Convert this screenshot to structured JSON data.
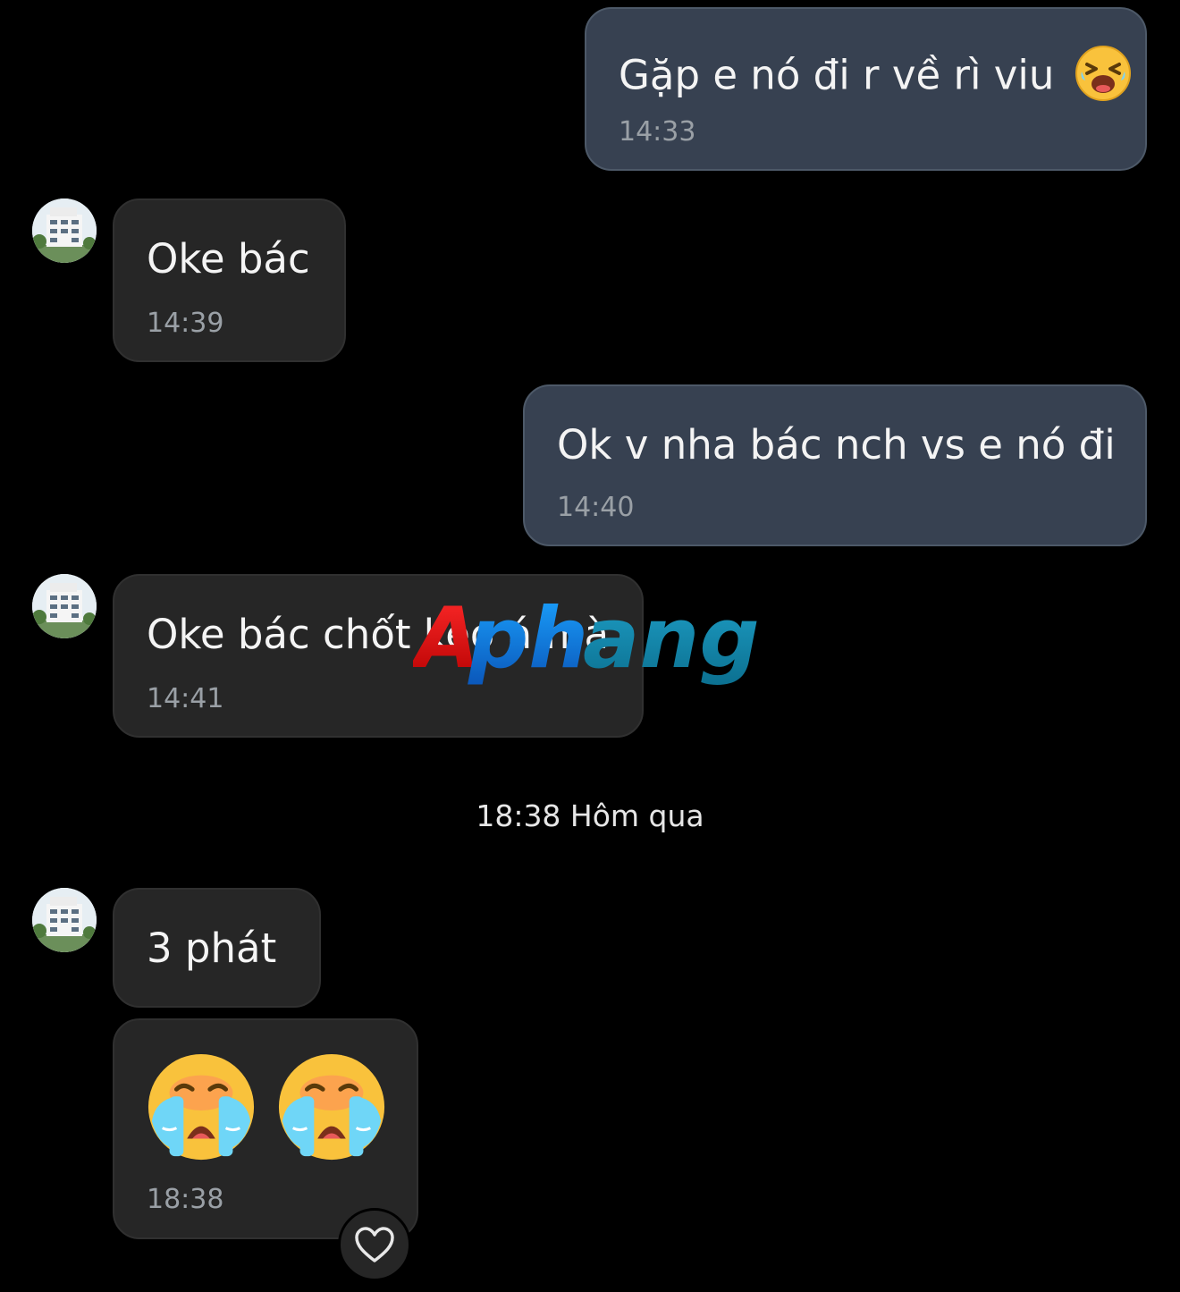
{
  "messages": [
    {
      "text": "Gặp e nó đi r về rì viu",
      "time": "14:33",
      "emoji": "laughing-crying-face"
    },
    {
      "text": "Oke bác",
      "time": "14:39"
    },
    {
      "text": "Ok v nha bác nch vs e nó đi",
      "time": "14:40"
    },
    {
      "text": "Oke bác chốt kèo á mà",
      "time": "14:41"
    },
    {
      "text": "3 phát"
    },
    {
      "time": "18:38",
      "emojis": [
        "loudly-crying-face",
        "loudly-crying-face"
      ]
    }
  ],
  "divider": {
    "label": "18:38 Hôm qua"
  },
  "reaction": {
    "icon": "heart-outline-icon"
  },
  "watermark": {
    "text": "Aphang"
  },
  "colors": {
    "background": "#000000",
    "outgoing_bubble": "#374151",
    "incoming_bubble": "#262626",
    "timestamp": "#9aa0a6"
  }
}
